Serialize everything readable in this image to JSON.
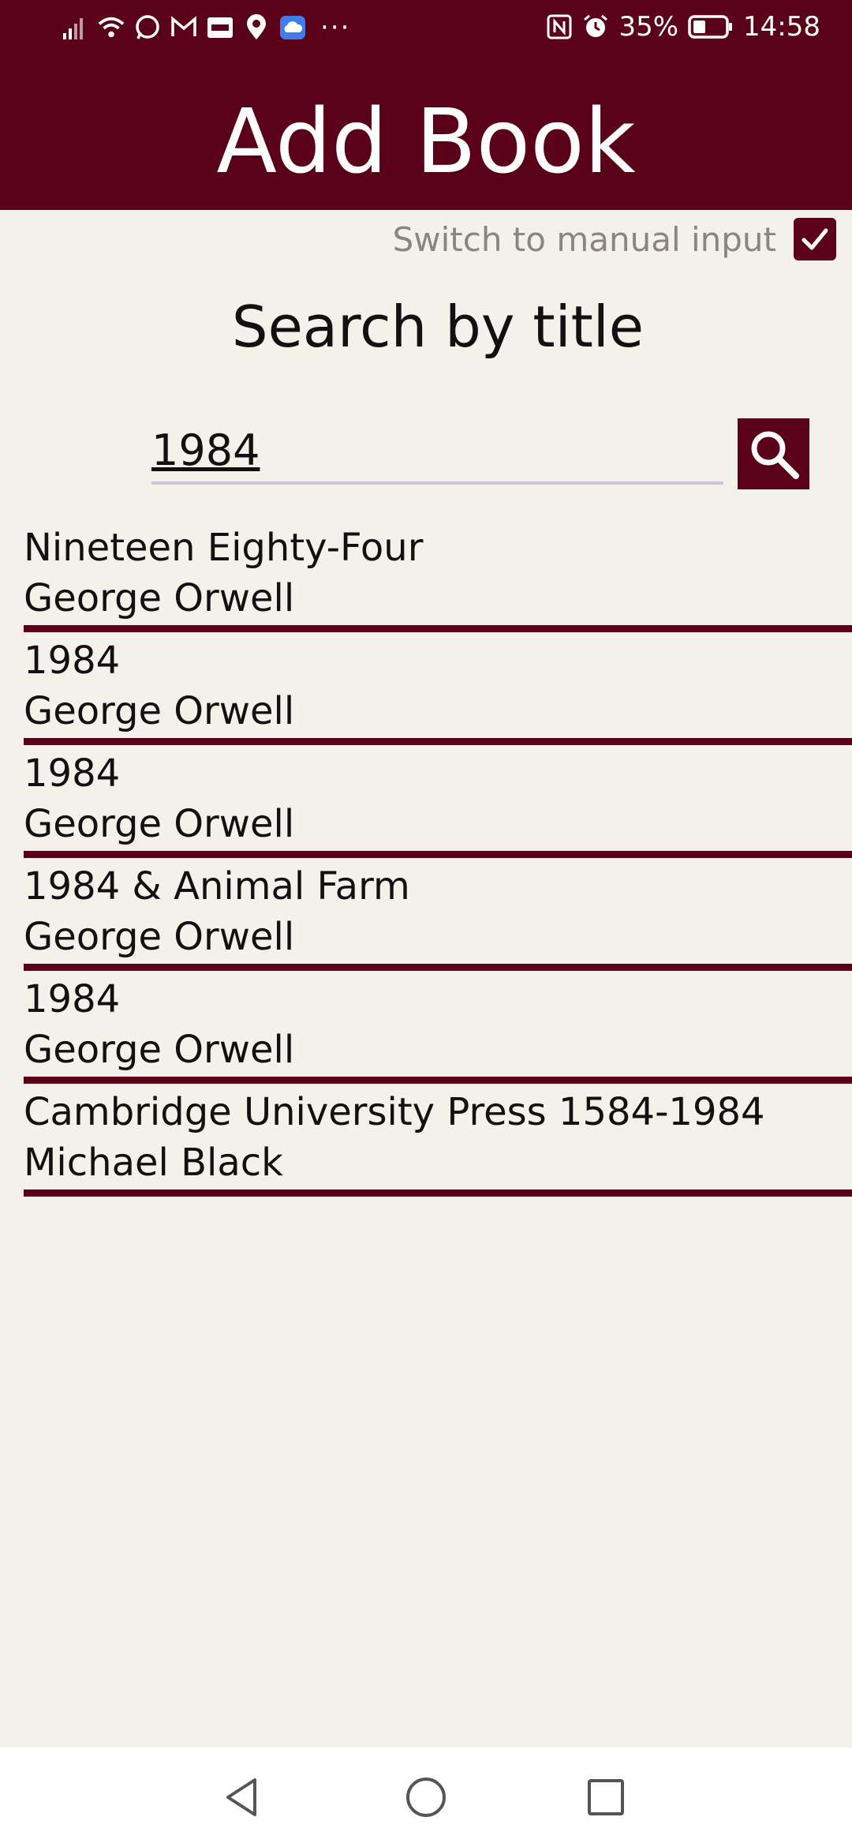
{
  "status_bar": {
    "icons": [
      "signal-icon",
      "wifi-icon",
      "whatsapp-icon",
      "gmail-icon",
      "mal-icon",
      "location-icon",
      "cloud-icon"
    ],
    "more": "···",
    "nfc_icon": "nfc-icon",
    "alarm_icon": "alarm-icon",
    "battery_percent": "35%",
    "time": "14:58"
  },
  "header": {
    "title": "Add Book"
  },
  "manual_input": {
    "label": "Switch to manual input",
    "checked": true
  },
  "search": {
    "title": "Search by title",
    "value": "1984"
  },
  "results": [
    {
      "title": "Nineteen Eighty-Four",
      "author": "George Orwell"
    },
    {
      "title": "1984",
      "author": "George Orwell"
    },
    {
      "title": "1984",
      "author": "George Orwell"
    },
    {
      "title": "1984 & Animal Farm",
      "author": "George Orwell"
    },
    {
      "title": "1984",
      "author": "George Orwell"
    },
    {
      "title": "Cambridge University Press 1584-1984",
      "author": "Michael Black"
    }
  ],
  "colors": {
    "primary": "#5a0018",
    "background": "#f4f0ea",
    "muted_text": "#8a8580"
  }
}
